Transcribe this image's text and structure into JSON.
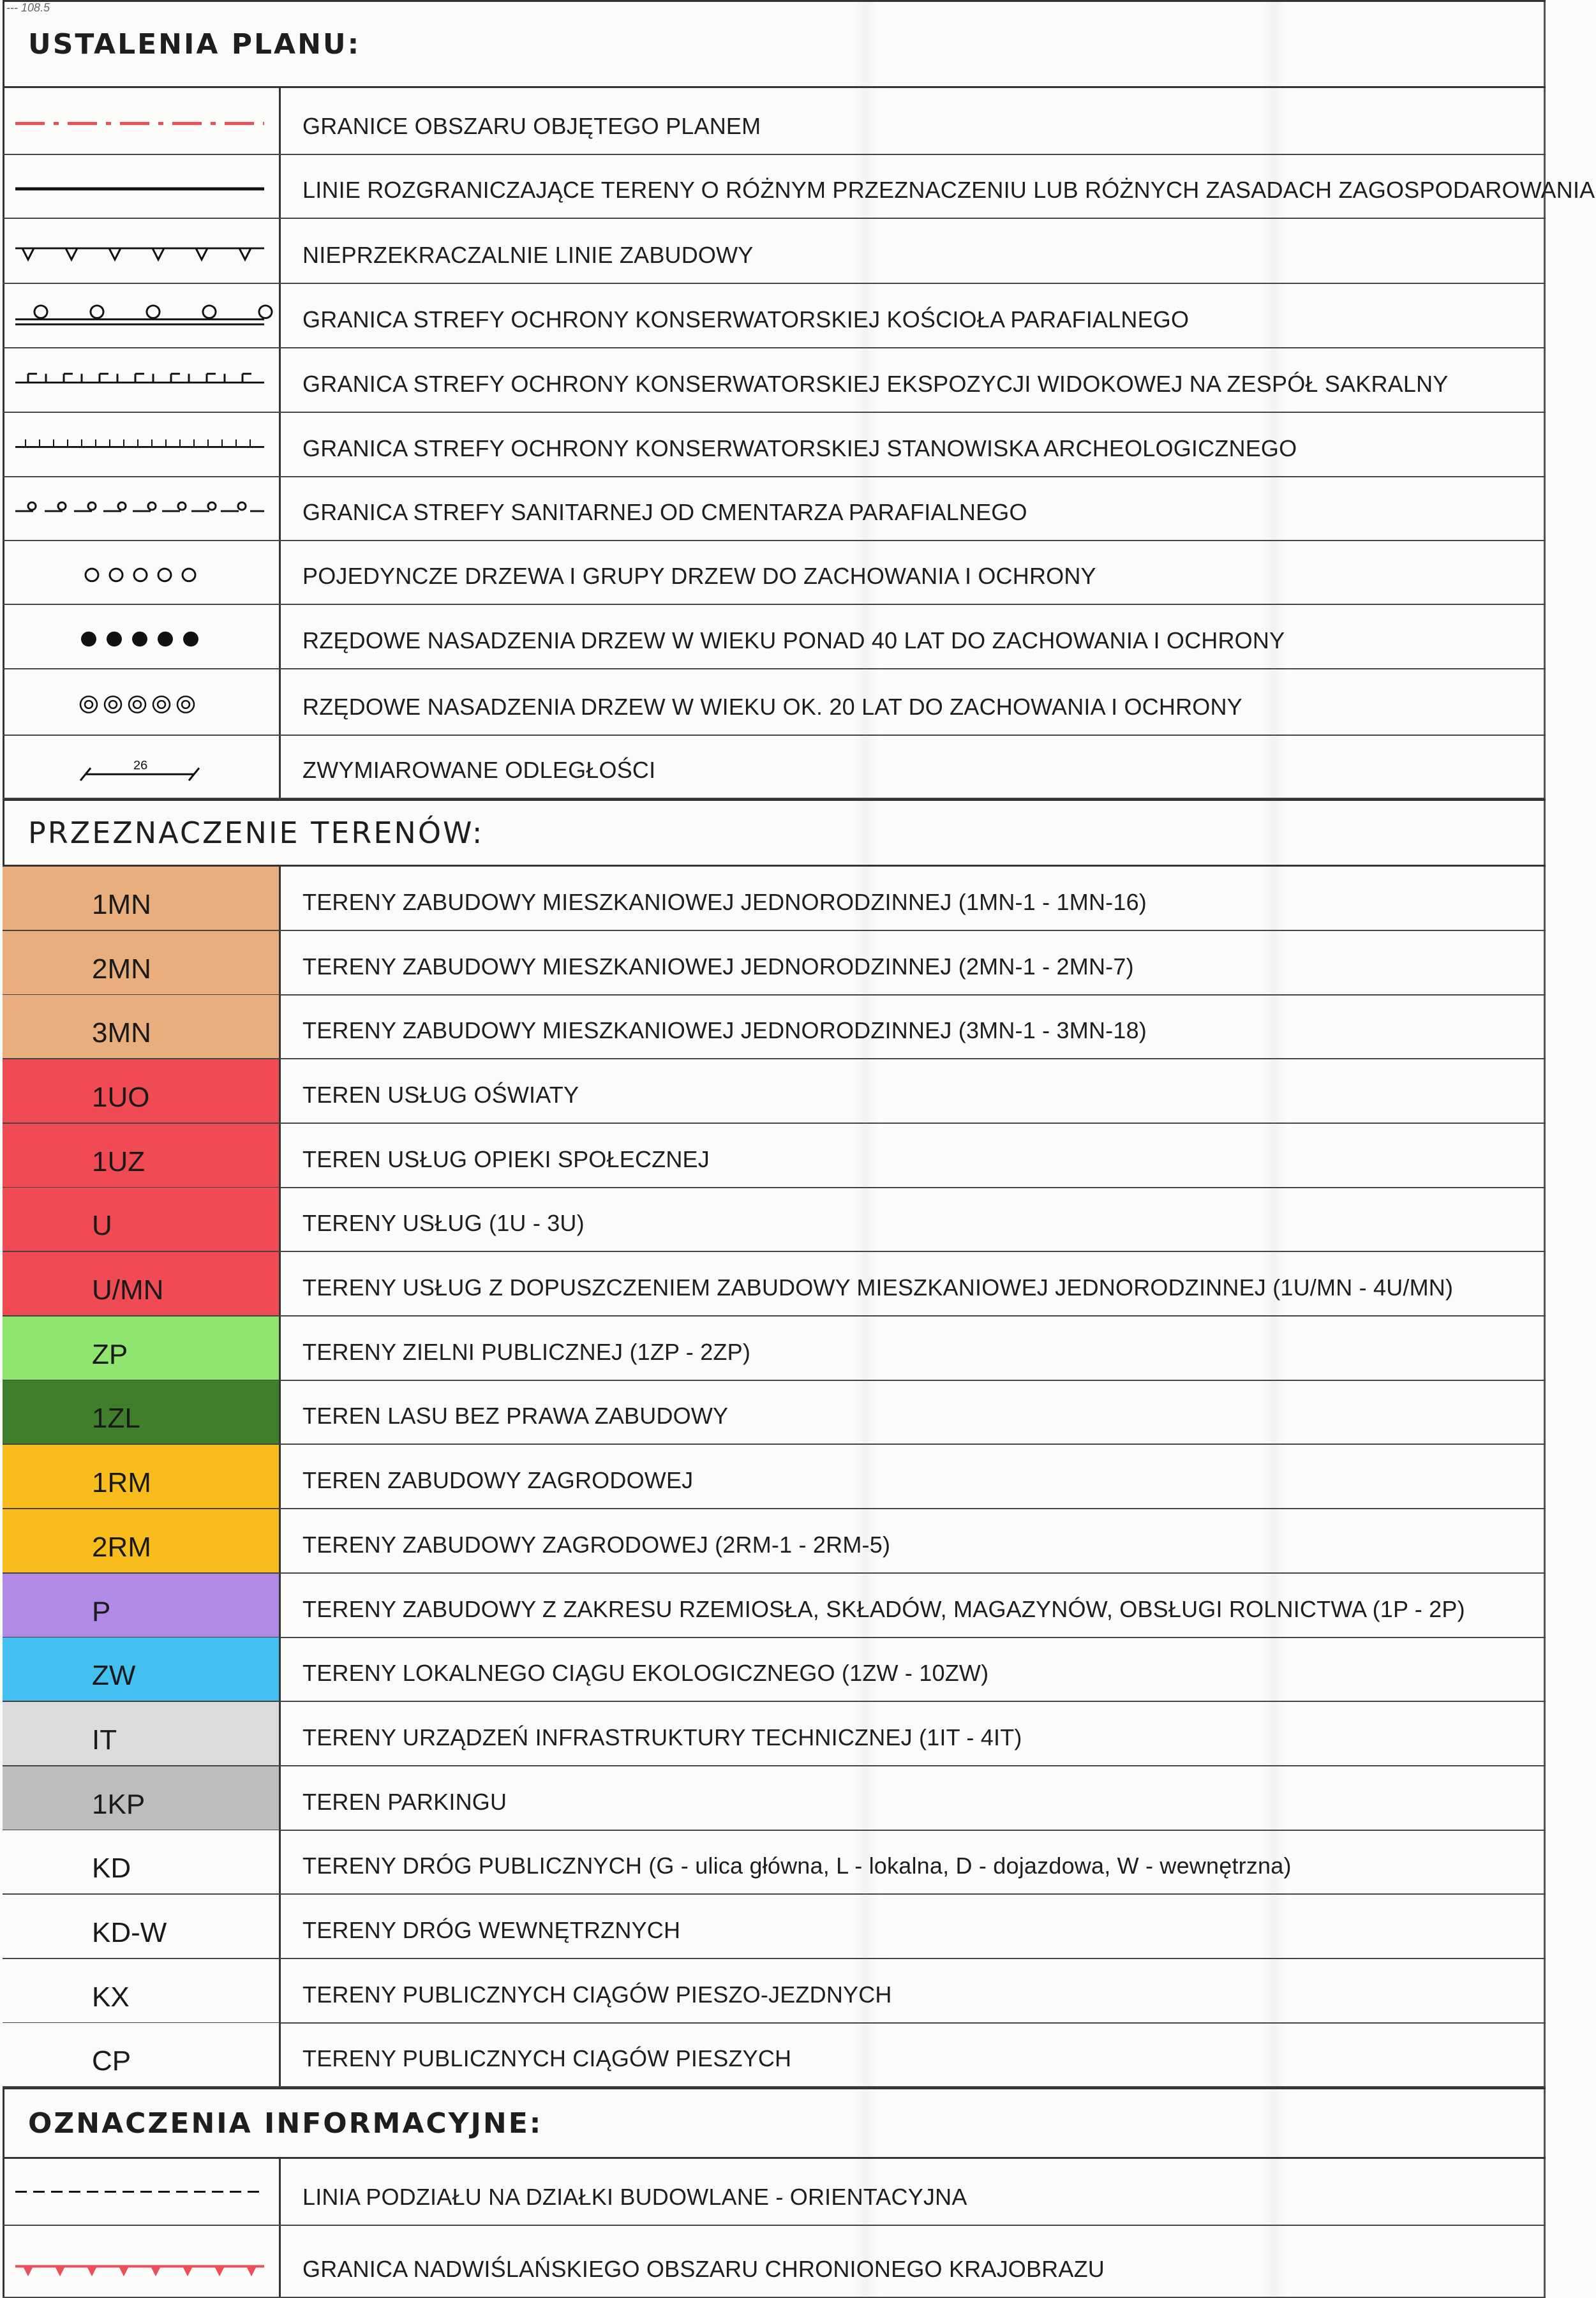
{
  "corner_note": "--- 108.5",
  "sections": {
    "ustalenia": "USTALENIA PLANU:",
    "przeznaczenie": "PRZEZNACZENIE TERENÓW:",
    "oznaczenia": "OZNACZENIA INFORMACYJNE:"
  },
  "line_legend": [
    {
      "symbol": "dash-dot-red-line",
      "label": "GRANICE OBSZARU OBJĘTEGO PLANEM"
    },
    {
      "symbol": "solid-black-line",
      "label": "LINIE ROZGRANICZAJĄCE TERENY O RÓŻNYM PRZEZNACZENIU LUB RÓŻNYCH ZASADACH ZAGOSPODAROWANIA"
    },
    {
      "symbol": "triangle-line",
      "label": "NIEPRZEKRACZALNIE LINIE ZABUDOWY"
    },
    {
      "symbol": "circle-double-line",
      "label": "GRANICA STREFY OCHRONY KONSERWATORSKIEJ KOŚCIOŁA PARAFIALNEGO"
    },
    {
      "symbol": "notch-line",
      "label": "GRANICA STREFY OCHRONY KONSERWATORSKIEJ EKSPOZYCJI WIDOKOWEJ NA ZESPÓŁ SAKRALNY"
    },
    {
      "symbol": "tick-line",
      "label": "GRANICA STREFY OCHRONY KONSERWATORSKIEJ STANOWISKA ARCHEOLOGICZNEGO"
    },
    {
      "symbol": "dot-dash-line",
      "label": "GRANICA STREFY SANITARNEJ OD CMENTARZA PARAFIALNEGO"
    },
    {
      "symbol": "open-circles",
      "label": "POJEDYNCZE DRZEWA I GRUPY DRZEW DO ZACHOWANIA I OCHRONY"
    },
    {
      "symbol": "filled-circles",
      "label": "RZĘDOWE NASADZENIA DRZEW W WIEKU PONAD 40 LAT DO ZACHOWANIA I OCHRONY"
    },
    {
      "symbol": "ringed-circles",
      "label": "RZĘDOWE NASADZENIA DRZEW W WIEKU OK. 20 LAT DO ZACHOWANIA I OCHRONY"
    },
    {
      "symbol": "dimension-line",
      "label": "ZWYMIAROWANE ODLEGŁOŚCI",
      "dimension_value": "26"
    }
  ],
  "zones": [
    {
      "code": "1MN",
      "color": "#e9ae7e",
      "label": "TERENY ZABUDOWY MIESZKANIOWEJ JEDNORODZINNEJ (1MN-1 - 1MN-16)"
    },
    {
      "code": "2MN",
      "color": "#e9ae7e",
      "label": "TERENY ZABUDOWY MIESZKANIOWEJ JEDNORODZINNEJ (2MN-1 - 2MN-7)"
    },
    {
      "code": "3MN",
      "color": "#e9ae7e",
      "label": "TERENY ZABUDOWY MIESZKANIOWEJ JEDNORODZINNEJ (3MN-1 - 3MN-18)"
    },
    {
      "code": "1UO",
      "color": "#f04a55",
      "label": "TEREN USŁUG OŚWIATY"
    },
    {
      "code": "1UZ",
      "color": "#f04a55",
      "label": "TEREN USŁUG OPIEKI SPOŁECZNEJ"
    },
    {
      "code": "U",
      "color": "#f04a55",
      "label": "TERENY USŁUG (1U - 3U)"
    },
    {
      "code": "U/MN",
      "color": "#f04a55",
      "pattern": "hatch",
      "label": "TERENY USŁUG Z DOPUSZCZENIEM ZABUDOWY MIESZKANIOWEJ JEDNORODZINNEJ (1U/MN - 4U/MN)"
    },
    {
      "code": "ZP",
      "color": "#8fe56e",
      "label": "TERENY ZIELNI PUBLICZNEJ (1ZP - 2ZP)"
    },
    {
      "code": "1ZL",
      "color": "#3f7f2c",
      "pattern": "grain",
      "label": "TEREN LASU BEZ PRAWA ZABUDOWY"
    },
    {
      "code": "1RM",
      "color": "#f8bd1c",
      "label": "TEREN ZABUDOWY ZAGRODOWEJ"
    },
    {
      "code": "2RM",
      "color": "#f8bd1c",
      "label": "TERENY ZABUDOWY ZAGRODOWEJ (2RM-1 - 2RM-5)"
    },
    {
      "code": "P",
      "color": "#b18ae6",
      "label": "TERENY ZABUDOWY Z ZAKRESU RZEMIOSŁA, SKŁADÓW, MAGAZYNÓW, OBSŁUGI ROLNICTWA (1P - 2P)"
    },
    {
      "code": "ZW",
      "color": "#43c0ef",
      "label": "TERENY LOKALNEGO CIĄGU EKOLOGICZNEGO (1ZW - 10ZW)"
    },
    {
      "code": "IT",
      "color": "#dcdcdf",
      "label": "TERENY URZĄDZEŃ INFRASTRUKTURY TECHNICZNEJ (1IT - 4IT)"
    },
    {
      "code": "1KP",
      "color": "#bdbdbf",
      "pattern": "grain",
      "label": "TEREN PARKINGU"
    },
    {
      "code": "KD",
      "color": "#fbfbf9",
      "label": "TERENY DRÓG PUBLICZNYCH (G - ulica główna, L - lokalna, D - dojazdowa, W - wewnętrzna)"
    },
    {
      "code": "KD-W",
      "color": "#fbfbf9",
      "label": "TERENY DRÓG WEWNĘTRZNYCH"
    },
    {
      "code": "KX",
      "color": "#fbfbf9",
      "label": "TERENY PUBLICZNYCH CIĄGÓW PIESZO-JEZDNYCH"
    },
    {
      "code": "CP",
      "color": "#fbfbf9",
      "label": "TERENY PUBLICZNYCH CIĄGÓW PIESZYCH"
    }
  ],
  "info_legend": [
    {
      "symbol": "dashed-black-line",
      "label": "LINIA PODZIAŁU NA DZIAŁKI BUDOWLANE - ORIENTACYJNA"
    },
    {
      "symbol": "red-triangle-line",
      "label": "GRANICA NADWIŚLAŃSKIEGO OBSZARU CHRONIONEGO KRAJOBRAZU"
    }
  ]
}
